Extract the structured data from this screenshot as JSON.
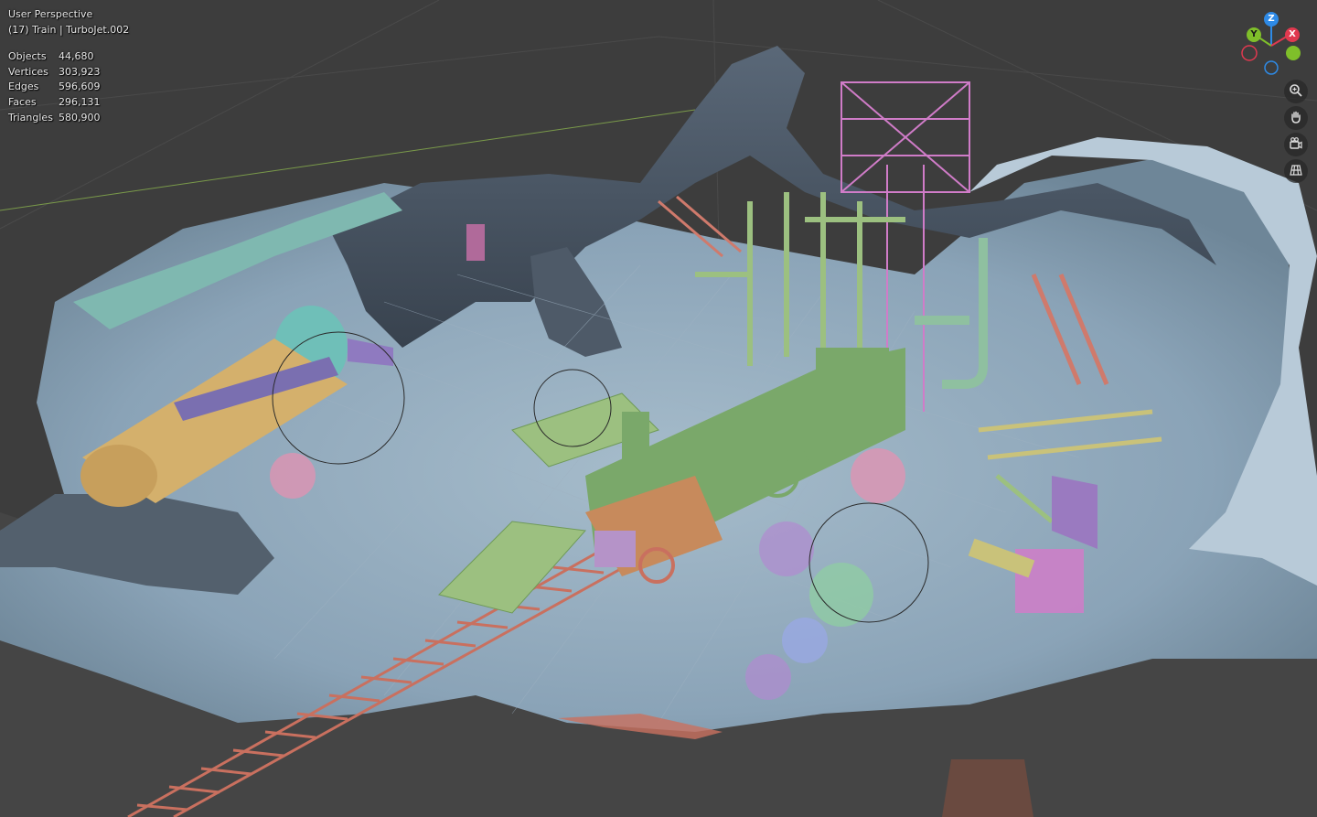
{
  "viewport": {
    "view_name": "User Perspective",
    "object_info": "(17) Train | TurboJet.002"
  },
  "stats": [
    {
      "label": "Objects",
      "value": "44,680"
    },
    {
      "label": "Vertices",
      "value": "303,923"
    },
    {
      "label": "Edges",
      "value": "596,609"
    },
    {
      "label": "Faces",
      "value": "296,131"
    },
    {
      "label": "Triangles",
      "value": "580,900"
    }
  ],
  "gizmo": {
    "z_label": "Z",
    "y_label": "Y",
    "x_label": "X",
    "colors": {
      "z": "#2e8ae6",
      "y": "#7fbf2a",
      "x": "#e0394f"
    }
  },
  "nav_tools": [
    {
      "icon": "zoom-icon"
    },
    {
      "icon": "pan-hand-icon"
    },
    {
      "icon": "camera-view-icon"
    },
    {
      "icon": "ortho-grid-icon"
    }
  ],
  "scene_colors": {
    "background": "#3d3d3d",
    "cave": "#8aa3b7",
    "rock_dark": "#4a5664",
    "rails": "#c9705f",
    "train_green": "#7aa86a",
    "wood": "#c9c27a",
    "scaffold": "#d07cc8",
    "turbine": "#d4b06c"
  }
}
